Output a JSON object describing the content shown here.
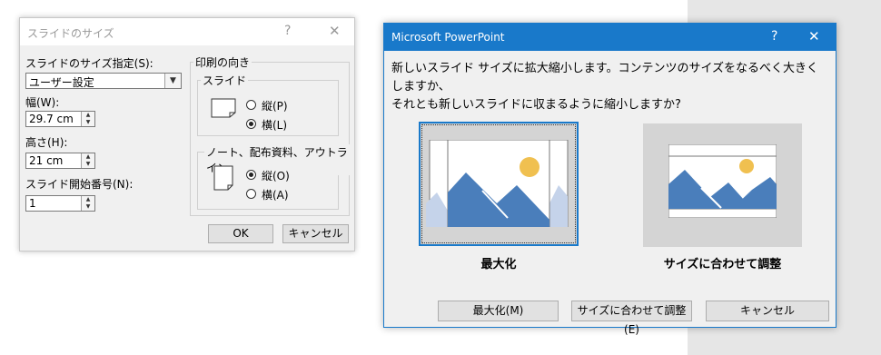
{
  "slide_size_dialog": {
    "title": "スライドのサイズ",
    "help": "?",
    "close": "✕",
    "size_label": "スライドのサイズ指定(S):",
    "size_value": "ユーザー設定",
    "width_label": "幅(W):",
    "width_value": "29.7 cm",
    "height_label": "高さ(H):",
    "height_value": "21 cm",
    "start_label": "スライド開始番号(N):",
    "start_value": "1",
    "orientation_label": "印刷の向き",
    "slides_group": "スライド",
    "slides_portrait": "縦(P)",
    "slides_landscape": "横(L)",
    "notes_group": "ノート、配布資料、アウトライン",
    "notes_portrait": "縦(O)",
    "notes_landscape": "横(A)",
    "ok": "OK",
    "cancel": "キャンセル"
  },
  "powerpoint_dialog": {
    "title": "Microsoft PowerPoint",
    "help": "?",
    "close": "✕",
    "message_line1": "新しいスライド サイズに拡大縮小します。コンテンツのサイズをなるべく大きくしますか、",
    "message_line2": "それとも新しいスライドに収まるように縮小しますか?",
    "option_maximize": "最大化",
    "option_fit": "サイズに合わせて調整",
    "btn_maximize": "最大化(M)",
    "btn_fit": "サイズに合わせて調整(E)",
    "btn_cancel": "キャンセル"
  },
  "colors": {
    "title_blue": "#1979ca",
    "mountain_blue": "#4a7ebb",
    "mountain_light": "#c5d3ea",
    "sun": "#f0c050"
  }
}
